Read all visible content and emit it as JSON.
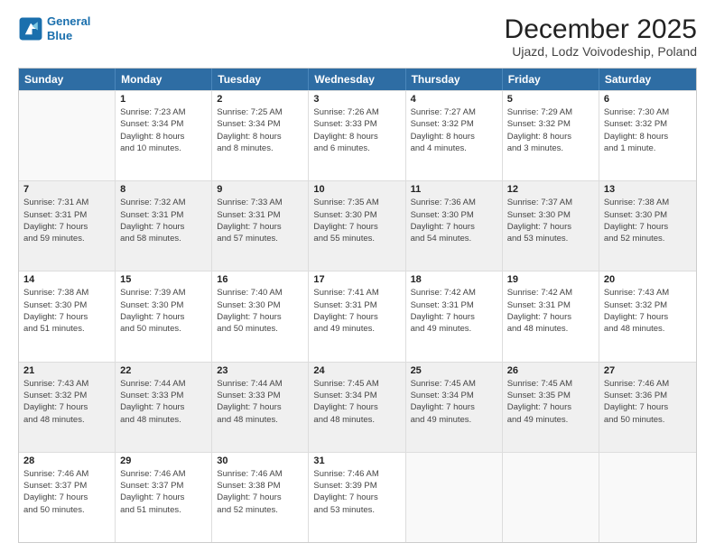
{
  "header": {
    "logo_line1": "General",
    "logo_line2": "Blue",
    "title": "December 2025",
    "subtitle": "Ujazd, Lodz Voivodeship, Poland"
  },
  "calendar": {
    "days": [
      "Sunday",
      "Monday",
      "Tuesday",
      "Wednesday",
      "Thursday",
      "Friday",
      "Saturday"
    ],
    "rows": [
      [
        {
          "day": "",
          "empty": true,
          "shaded": false,
          "lines": []
        },
        {
          "day": "1",
          "empty": false,
          "shaded": false,
          "lines": [
            "Sunrise: 7:23 AM",
            "Sunset: 3:34 PM",
            "Daylight: 8 hours",
            "and 10 minutes."
          ]
        },
        {
          "day": "2",
          "empty": false,
          "shaded": false,
          "lines": [
            "Sunrise: 7:25 AM",
            "Sunset: 3:34 PM",
            "Daylight: 8 hours",
            "and 8 minutes."
          ]
        },
        {
          "day": "3",
          "empty": false,
          "shaded": false,
          "lines": [
            "Sunrise: 7:26 AM",
            "Sunset: 3:33 PM",
            "Daylight: 8 hours",
            "and 6 minutes."
          ]
        },
        {
          "day": "4",
          "empty": false,
          "shaded": false,
          "lines": [
            "Sunrise: 7:27 AM",
            "Sunset: 3:32 PM",
            "Daylight: 8 hours",
            "and 4 minutes."
          ]
        },
        {
          "day": "5",
          "empty": false,
          "shaded": false,
          "lines": [
            "Sunrise: 7:29 AM",
            "Sunset: 3:32 PM",
            "Daylight: 8 hours",
            "and 3 minutes."
          ]
        },
        {
          "day": "6",
          "empty": false,
          "shaded": false,
          "lines": [
            "Sunrise: 7:30 AM",
            "Sunset: 3:32 PM",
            "Daylight: 8 hours",
            "and 1 minute."
          ]
        }
      ],
      [
        {
          "day": "7",
          "empty": false,
          "shaded": true,
          "lines": [
            "Sunrise: 7:31 AM",
            "Sunset: 3:31 PM",
            "Daylight: 7 hours",
            "and 59 minutes."
          ]
        },
        {
          "day": "8",
          "empty": false,
          "shaded": true,
          "lines": [
            "Sunrise: 7:32 AM",
            "Sunset: 3:31 PM",
            "Daylight: 7 hours",
            "and 58 minutes."
          ]
        },
        {
          "day": "9",
          "empty": false,
          "shaded": true,
          "lines": [
            "Sunrise: 7:33 AM",
            "Sunset: 3:31 PM",
            "Daylight: 7 hours",
            "and 57 minutes."
          ]
        },
        {
          "day": "10",
          "empty": false,
          "shaded": true,
          "lines": [
            "Sunrise: 7:35 AM",
            "Sunset: 3:30 PM",
            "Daylight: 7 hours",
            "and 55 minutes."
          ]
        },
        {
          "day": "11",
          "empty": false,
          "shaded": true,
          "lines": [
            "Sunrise: 7:36 AM",
            "Sunset: 3:30 PM",
            "Daylight: 7 hours",
            "and 54 minutes."
          ]
        },
        {
          "day": "12",
          "empty": false,
          "shaded": true,
          "lines": [
            "Sunrise: 7:37 AM",
            "Sunset: 3:30 PM",
            "Daylight: 7 hours",
            "and 53 minutes."
          ]
        },
        {
          "day": "13",
          "empty": false,
          "shaded": true,
          "lines": [
            "Sunrise: 7:38 AM",
            "Sunset: 3:30 PM",
            "Daylight: 7 hours",
            "and 52 minutes."
          ]
        }
      ],
      [
        {
          "day": "14",
          "empty": false,
          "shaded": false,
          "lines": [
            "Sunrise: 7:38 AM",
            "Sunset: 3:30 PM",
            "Daylight: 7 hours",
            "and 51 minutes."
          ]
        },
        {
          "day": "15",
          "empty": false,
          "shaded": false,
          "lines": [
            "Sunrise: 7:39 AM",
            "Sunset: 3:30 PM",
            "Daylight: 7 hours",
            "and 50 minutes."
          ]
        },
        {
          "day": "16",
          "empty": false,
          "shaded": false,
          "lines": [
            "Sunrise: 7:40 AM",
            "Sunset: 3:30 PM",
            "Daylight: 7 hours",
            "and 50 minutes."
          ]
        },
        {
          "day": "17",
          "empty": false,
          "shaded": false,
          "lines": [
            "Sunrise: 7:41 AM",
            "Sunset: 3:31 PM",
            "Daylight: 7 hours",
            "and 49 minutes."
          ]
        },
        {
          "day": "18",
          "empty": false,
          "shaded": false,
          "lines": [
            "Sunrise: 7:42 AM",
            "Sunset: 3:31 PM",
            "Daylight: 7 hours",
            "and 49 minutes."
          ]
        },
        {
          "day": "19",
          "empty": false,
          "shaded": false,
          "lines": [
            "Sunrise: 7:42 AM",
            "Sunset: 3:31 PM",
            "Daylight: 7 hours",
            "and 48 minutes."
          ]
        },
        {
          "day": "20",
          "empty": false,
          "shaded": false,
          "lines": [
            "Sunrise: 7:43 AM",
            "Sunset: 3:32 PM",
            "Daylight: 7 hours",
            "and 48 minutes."
          ]
        }
      ],
      [
        {
          "day": "21",
          "empty": false,
          "shaded": true,
          "lines": [
            "Sunrise: 7:43 AM",
            "Sunset: 3:32 PM",
            "Daylight: 7 hours",
            "and 48 minutes."
          ]
        },
        {
          "day": "22",
          "empty": false,
          "shaded": true,
          "lines": [
            "Sunrise: 7:44 AM",
            "Sunset: 3:33 PM",
            "Daylight: 7 hours",
            "and 48 minutes."
          ]
        },
        {
          "day": "23",
          "empty": false,
          "shaded": true,
          "lines": [
            "Sunrise: 7:44 AM",
            "Sunset: 3:33 PM",
            "Daylight: 7 hours",
            "and 48 minutes."
          ]
        },
        {
          "day": "24",
          "empty": false,
          "shaded": true,
          "lines": [
            "Sunrise: 7:45 AM",
            "Sunset: 3:34 PM",
            "Daylight: 7 hours",
            "and 48 minutes."
          ]
        },
        {
          "day": "25",
          "empty": false,
          "shaded": true,
          "lines": [
            "Sunrise: 7:45 AM",
            "Sunset: 3:34 PM",
            "Daylight: 7 hours",
            "and 49 minutes."
          ]
        },
        {
          "day": "26",
          "empty": false,
          "shaded": true,
          "lines": [
            "Sunrise: 7:45 AM",
            "Sunset: 3:35 PM",
            "Daylight: 7 hours",
            "and 49 minutes."
          ]
        },
        {
          "day": "27",
          "empty": false,
          "shaded": true,
          "lines": [
            "Sunrise: 7:46 AM",
            "Sunset: 3:36 PM",
            "Daylight: 7 hours",
            "and 50 minutes."
          ]
        }
      ],
      [
        {
          "day": "28",
          "empty": false,
          "shaded": false,
          "lines": [
            "Sunrise: 7:46 AM",
            "Sunset: 3:37 PM",
            "Daylight: 7 hours",
            "and 50 minutes."
          ]
        },
        {
          "day": "29",
          "empty": false,
          "shaded": false,
          "lines": [
            "Sunrise: 7:46 AM",
            "Sunset: 3:37 PM",
            "Daylight: 7 hours",
            "and 51 minutes."
          ]
        },
        {
          "day": "30",
          "empty": false,
          "shaded": false,
          "lines": [
            "Sunrise: 7:46 AM",
            "Sunset: 3:38 PM",
            "Daylight: 7 hours",
            "and 52 minutes."
          ]
        },
        {
          "day": "31",
          "empty": false,
          "shaded": false,
          "lines": [
            "Sunrise: 7:46 AM",
            "Sunset: 3:39 PM",
            "Daylight: 7 hours",
            "and 53 minutes."
          ]
        },
        {
          "day": "",
          "empty": true,
          "shaded": false,
          "lines": []
        },
        {
          "day": "",
          "empty": true,
          "shaded": false,
          "lines": []
        },
        {
          "day": "",
          "empty": true,
          "shaded": false,
          "lines": []
        }
      ]
    ]
  }
}
